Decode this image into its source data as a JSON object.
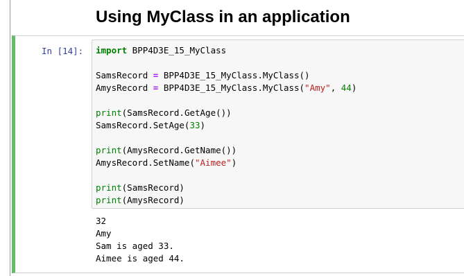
{
  "heading": "Using MyClass in an application",
  "cell": {
    "prompt": "In [14]:",
    "code": {
      "l1_kw": "import",
      "l1_rest": " BPP4D3E_15_MyClass",
      "l2_a": "SamsRecord ",
      "l2_op": "=",
      "l2_b": " BPP4D3E_15_MyClass.MyClass()",
      "l3_a": "AmysRecord ",
      "l3_op": "=",
      "l3_b": " BPP4D3E_15_MyClass.MyClass(",
      "l3_str": "\"Amy\"",
      "l3_c": ", ",
      "l3_num": "44",
      "l3_d": ")",
      "l4_bi": "print",
      "l4_rest": "(SamsRecord.GetAge())",
      "l5_a": "SamsRecord.SetAge(",
      "l5_num": "33",
      "l5_b": ")",
      "l6_bi": "print",
      "l6_rest": "(AmysRecord.GetName())",
      "l7_a": "AmysRecord.SetName(",
      "l7_str": "\"Aimee\"",
      "l7_b": ")",
      "l8_bi": "print",
      "l8_rest": "(SamsRecord)",
      "l9_bi": "print",
      "l9_rest": "(AmysRecord)"
    },
    "output_lines": [
      "32",
      "Amy",
      "Sam is aged 33.",
      "Aimee is aged 44."
    ]
  },
  "colors": {
    "cell_accent": "#66bb6a",
    "prompt": "#303f9f",
    "keyword": "#008000",
    "string": "#ba2121",
    "operator": "#aa22ff"
  }
}
